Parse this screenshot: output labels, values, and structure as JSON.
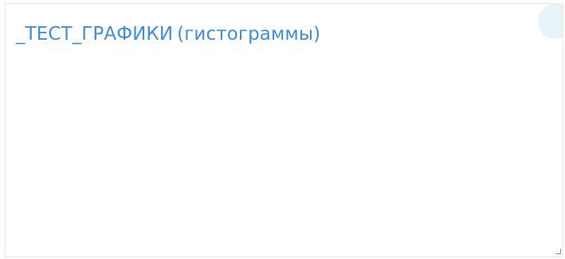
{
  "widget": {
    "title": "_ТЕСТ_ГРАФИКИ",
    "subtitle": "(гистограммы)",
    "title_color": "#3b8ee6",
    "corner_button_color": "#e8f3f8",
    "icons": {
      "corner_button": "circle-icon",
      "resize_handle": "resize-corner-icon"
    }
  }
}
